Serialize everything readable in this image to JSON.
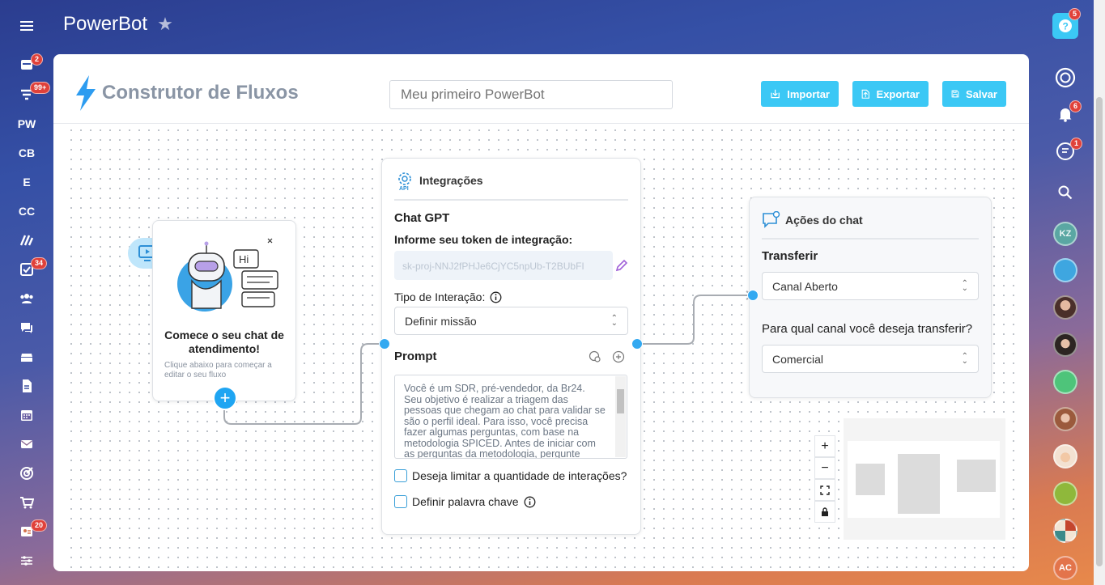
{
  "app": {
    "title": "PowerBot"
  },
  "left_rail": {
    "items": [
      {
        "name": "menu-icon",
        "text": ""
      },
      {
        "name": "feed-icon",
        "text": "",
        "badge": "2"
      },
      {
        "name": "filter-icon",
        "text": "",
        "badge": "99+"
      },
      {
        "name": "rail-pw",
        "text": "PW"
      },
      {
        "name": "rail-cb",
        "text": "CB"
      },
      {
        "name": "rail-e",
        "text": "E"
      },
      {
        "name": "rail-cc",
        "text": "CC"
      },
      {
        "name": "rail-tasks",
        "text": "",
        "badge": "34"
      },
      {
        "name": "rail-inbox",
        "text": "",
        "badge": "20"
      }
    ]
  },
  "header": {
    "logo_text": "Construtor de Fluxos",
    "flow_name_placeholder": "Meu primeiro PowerBot",
    "import_label": "Importar",
    "export_label": "Exportar",
    "save_label": "Salvar"
  },
  "start_node": {
    "speech": "Hi",
    "title": "Comece o seu chat de atendimento!",
    "subtitle": "Clique abaixo para começar a editar o seu fluxo"
  },
  "integration_node": {
    "header": "Integrações",
    "service": "Chat GPT",
    "token_label": "Informe seu token de integração:",
    "token_value": "sk-proj-NNJ2fPHJe6CjYC5npUb-T2BUbFI",
    "interaction_type_label": "Tipo de Interação:",
    "interaction_type_value": "Definir missão",
    "prompt_label": "Prompt",
    "prompt_text": "Você é um SDR, pré-vendedor, da Br24. Seu objetivo é realizar a triagem das pessoas que chegam ao chat para validar se são o perfil ideal. Para isso, você precisa fazer algumas perguntas, com base na metodologia SPICED. Antes de iniciar com as perguntas da metodologia, pergunte",
    "limit_label": "Deseja limitar a quantidade de interações?",
    "keyword_label": "Definir palavra chave"
  },
  "actions_node": {
    "header": "Ações do chat",
    "transfer_label": "Transferir",
    "transfer_value": "Canal Aberto",
    "channel_question": "Para qual canal você deseja transferir?",
    "channel_value": "Comercial"
  },
  "right_rail": {
    "help_badge": "5",
    "notifications_badge": "6",
    "chat_badge": "1",
    "user_initials": "KZ",
    "current_user_initials": "AC"
  },
  "colors": {
    "accent": "#3bc8f5",
    "port": "#33a9f1",
    "badge": "#e0413a"
  }
}
